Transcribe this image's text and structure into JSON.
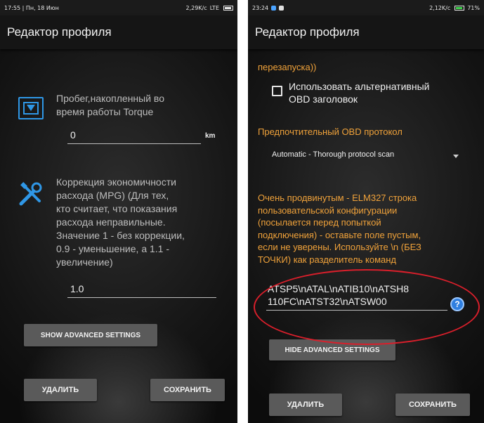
{
  "screen_left": {
    "status_bar": {
      "left": "17:55 | Пн, 18 Июн",
      "speed": "2,29K/с",
      "network": "LTE"
    },
    "title": "Редактор профиля",
    "mileage": {
      "label_line1": "Пробег,накопленный во",
      "label_line2": "время работы Torque",
      "value": "0",
      "unit": "km"
    },
    "mpg": {
      "label_lines": [
        "Коррекция экономичности",
        "расхода (MPG) (Для тех,",
        "кто считает, что показания",
        "расхода неправильные.",
        "Значение 1 - без коррекции,",
        "0.9 - уменьшение, а 1.1 -",
        "увеличение)"
      ],
      "value": "1.0"
    },
    "show_advanced_label": "SHOW ADVANCED SETTINGS",
    "delete_label": "УДАЛИТЬ",
    "save_label": "СОХРАНИТЬ"
  },
  "screen_right": {
    "status_bar": {
      "time": "23:24",
      "speed": "2,12K/с",
      "battery": "71%"
    },
    "title": "Редактор профиля",
    "partial_text": "перезапуска))",
    "alt_header_lines": [
      "Использовать альтернативный",
      "OBD заголовок"
    ],
    "protocol_label": "Предпочтительный OBD протокол",
    "protocol_value": "Automatic - Thorough protocol scan",
    "elm_note_lines": [
      "Очень продвинутым - ELM327 строка",
      "пользовательской конфигурации",
      "(посылается перед попыткой",
      "подключения) - оставьте поле пустым,",
      "если не уверены. Используйте \\n (БЕЗ",
      "ТОЧКИ) как разделитель команд"
    ],
    "config_lines": [
      "ATSP5\\nATAL\\nATIB10\\nATSH8",
      "110FC\\nATST32\\nATSW00"
    ],
    "help_label": "?",
    "hide_advanced_label": "HIDE ADVANCED SETTINGS",
    "delete_label": "УДАЛИТЬ",
    "save_label": "СОХРАНИТЬ"
  },
  "icons": {
    "mileage": "dashboard-screen-icon",
    "mpg": "tools-icon",
    "help": "question-circle-icon",
    "checkbox": "checkbox-unchecked"
  },
  "colors": {
    "accent_orange": "#f0a23a",
    "icon_blue": "#2f97e6",
    "highlight_red": "#d91f2b",
    "button_grey": "#5a5a5a"
  }
}
